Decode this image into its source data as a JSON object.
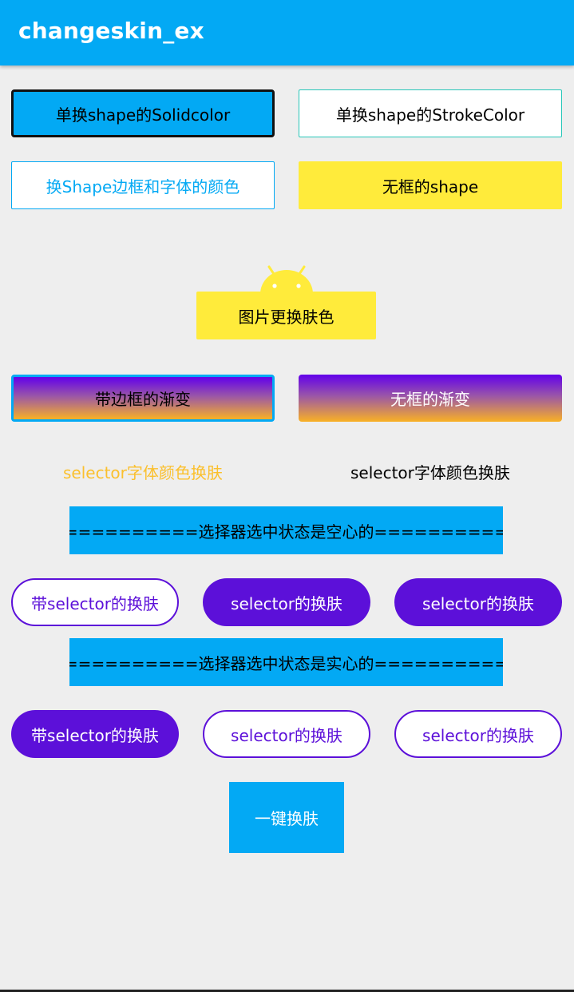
{
  "appbar": {
    "title": "changeskin_ex",
    "color": "#03a9f4"
  },
  "buttons": {
    "solid_color": "单换shape的Solidcolor",
    "stroke_color": "单换shape的StrokeColor",
    "stroke_and_text": "换Shape边框和字体的颜色",
    "no_border_shape": "无框的shape",
    "image_skin": "图片更换肤色",
    "gradient_border": "带边框的渐变",
    "gradient_no_border": "无框的渐变"
  },
  "selector_text": {
    "left": "selector字体颜色换肤",
    "right": "selector字体颜色换肤"
  },
  "banners": {
    "hollow": "============选择器选中状态是空心的============",
    "solid": "============选择器选中状态是实心的============"
  },
  "pills_row1": [
    {
      "label": "带selector的换肤",
      "style": "outline"
    },
    {
      "label": "selector的换肤",
      "style": "solid"
    },
    {
      "label": "selector的换肤",
      "style": "solid"
    }
  ],
  "pills_row2": [
    {
      "label": "带selector的换肤",
      "style": "solid"
    },
    {
      "label": "selector的换肤",
      "style": "outline"
    },
    {
      "label": "selector的换肤",
      "style": "outline"
    }
  ],
  "one_click": "一键换肤",
  "icons": {
    "android": "android-icon"
  },
  "colors": {
    "accent_blue": "#03a9f4",
    "yellow": "#ffeb3b",
    "purple": "#5c10d9",
    "selector_yellow": "#fbc02d",
    "gradient_top": "#6200ea",
    "gradient_bottom": "#f9b125"
  }
}
